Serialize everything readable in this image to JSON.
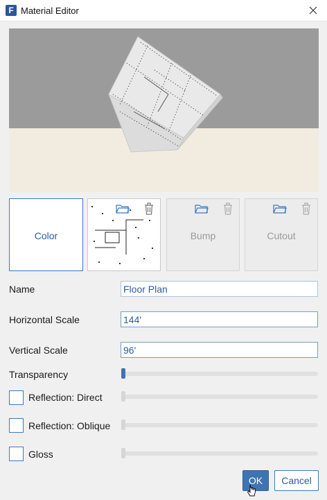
{
  "window": {
    "title": "Material Editor",
    "app_icon_letter": "F"
  },
  "slots": {
    "color_label": "Color",
    "bump_label": "Bump",
    "cutout_label": "Cutout"
  },
  "form": {
    "name_label": "Name",
    "name_value": "Floor Plan",
    "hscale_label": "Horizontal Scale",
    "hscale_value": "144'",
    "vscale_label": "Vertical Scale",
    "vscale_value": "96'",
    "transparency_label": "Transparency",
    "reflection_direct_label": "Reflection: Direct",
    "reflection_oblique_label": "Reflection: Oblique",
    "gloss_label": "Gloss"
  },
  "sliders": {
    "transparency": 0,
    "reflection_direct": 0,
    "reflection_oblique": 0,
    "gloss": 0
  },
  "checkboxes": {
    "reflection_direct": false,
    "reflection_oblique": false,
    "gloss": false
  },
  "buttons": {
    "ok_label": "OK",
    "cancel_label": "Cancel"
  },
  "colors": {
    "accent": "#3f74b3",
    "preview_sky": "#9b9b9b",
    "preview_floor": "#f2ece0"
  }
}
